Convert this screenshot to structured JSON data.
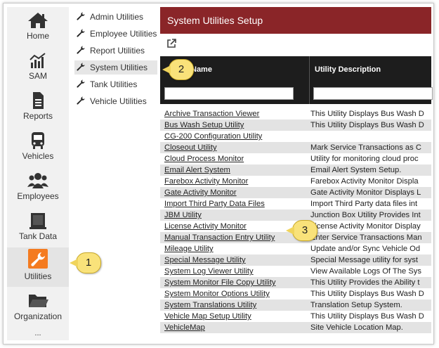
{
  "leftnav": {
    "items": [
      {
        "label": "Home",
        "icon": "home-icon"
      },
      {
        "label": "SAM",
        "icon": "chart-icon"
      },
      {
        "label": "Reports",
        "icon": "document-icon"
      },
      {
        "label": "Vehicles",
        "icon": "bus-icon"
      },
      {
        "label": "Employees",
        "icon": "users-icon"
      },
      {
        "label": "Tank Data",
        "icon": "tank-icon"
      },
      {
        "label": "Utilities",
        "icon": "wrench-icon"
      },
      {
        "label": "Organization",
        "icon": "folder-icon"
      }
    ],
    "more": "..."
  },
  "submenu": {
    "items": [
      {
        "label": "Admin Utilities"
      },
      {
        "label": "Employee Utilities"
      },
      {
        "label": "Report Utilities"
      },
      {
        "label": "System Utilities"
      },
      {
        "label": "Tank Utilities"
      },
      {
        "label": "Vehicle Utilities"
      }
    ]
  },
  "main": {
    "title": "System Utilities Setup",
    "columns": {
      "name": "Name",
      "description": "Utility Description"
    },
    "rows": [
      {
        "name": "Archive Transaction Viewer",
        "desc": "This Utility Displays Bus Wash D"
      },
      {
        "name": "Bus Wash Setup Utility",
        "desc": "This Utility Displays Bus Wash D"
      },
      {
        "name": "CG-200 Configuration Utility",
        "desc": ""
      },
      {
        "name": "Closeout Utility",
        "desc": "Mark Service Transactions as C"
      },
      {
        "name": "Cloud Process Monitor",
        "desc": "Utility for monitoring cloud proc"
      },
      {
        "name": "Email Alert System",
        "desc": "Email Alert System Setup."
      },
      {
        "name": "Farebox Activity Monitor",
        "desc": "Farebox Activity Monitor Displa"
      },
      {
        "name": "Gate Activity Monitor",
        "desc": "Gate Activity Monitor Displays L"
      },
      {
        "name": "Import Third Party Data Files",
        "desc": "Import Third Party data files int"
      },
      {
        "name": "JBM Utility",
        "desc": "Junction Box Utility Provides Int"
      },
      {
        "name": "License Activity Monitor",
        "desc": "License Activity Monitor Display"
      },
      {
        "name": "Manual Transaction Entry Utility",
        "desc": "Enter Service Transactions Man"
      },
      {
        "name": "Mileage Utility",
        "desc": "Update and/or Sync Vehicle Od"
      },
      {
        "name": "Special Message Utility",
        "desc": "Special Message utility for syst"
      },
      {
        "name": "System Log Viewer Utility",
        "desc": "View Available Logs Of The Sys"
      },
      {
        "name": "System Monitor File Copy Utility",
        "desc": "This Utility Provides the Ability t"
      },
      {
        "name": "System Monitor Options Utility",
        "desc": "This Utility Displays Bus Wash D"
      },
      {
        "name": "System Translations Utility",
        "desc": "Translation Setup System."
      },
      {
        "name": "Vehicle Map Setup Utility",
        "desc": "This Utility Displays Bus Wash D"
      },
      {
        "name": "VehicleMap",
        "desc": "Site Vehicle Location Map."
      }
    ]
  },
  "callouts": [
    "1",
    "2",
    "3"
  ],
  "colors": {
    "titlebar": "#8a2528",
    "accent": "#f47b20",
    "header": "#1d1d1d",
    "callout": "#f9e27a"
  }
}
